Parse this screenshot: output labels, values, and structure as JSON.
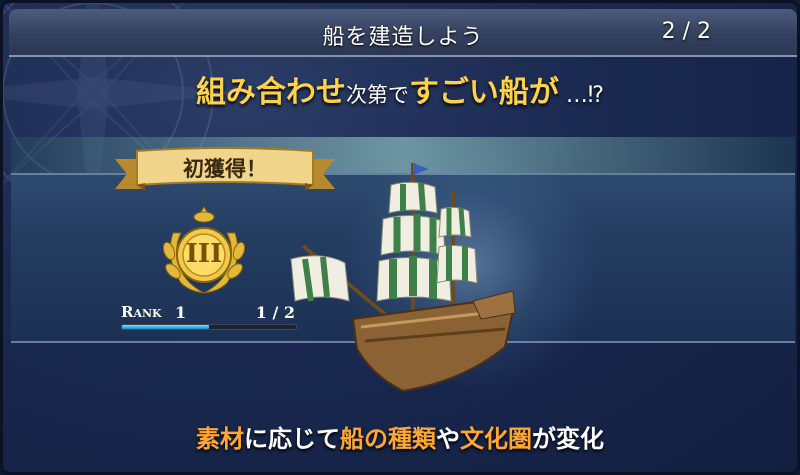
{
  "dialog": {
    "title": "船を建造しよう",
    "page_counter": "2 / 2"
  },
  "headline": {
    "part1": "組み合わせ",
    "part2": "次第で",
    "part3": "すごい船が",
    "part4": " …⁉"
  },
  "badge": {
    "ribbon_text": "初獲得！",
    "medal_numeral": "III"
  },
  "rank": {
    "label": "Rank",
    "value": "1",
    "progress_text": "1 / 2",
    "progress_fraction": 0.5
  },
  "footer": {
    "s1": "素材",
    "s2": "に応じて",
    "s3": "船の種類",
    "s4": "や",
    "s5": "文化圏",
    "s6": "が変化"
  },
  "colors": {
    "accent_gold": "#ffd24a",
    "accent_orange": "#ffa633",
    "sail_green": "#3f7f4a",
    "sail_white": "#efeee0",
    "hull_wood": "#8a6234"
  },
  "icons": [
    "compass-rose-icon",
    "laurel-medal-icon",
    "ribbon-banner-icon",
    "sailing-ship-icon"
  ]
}
